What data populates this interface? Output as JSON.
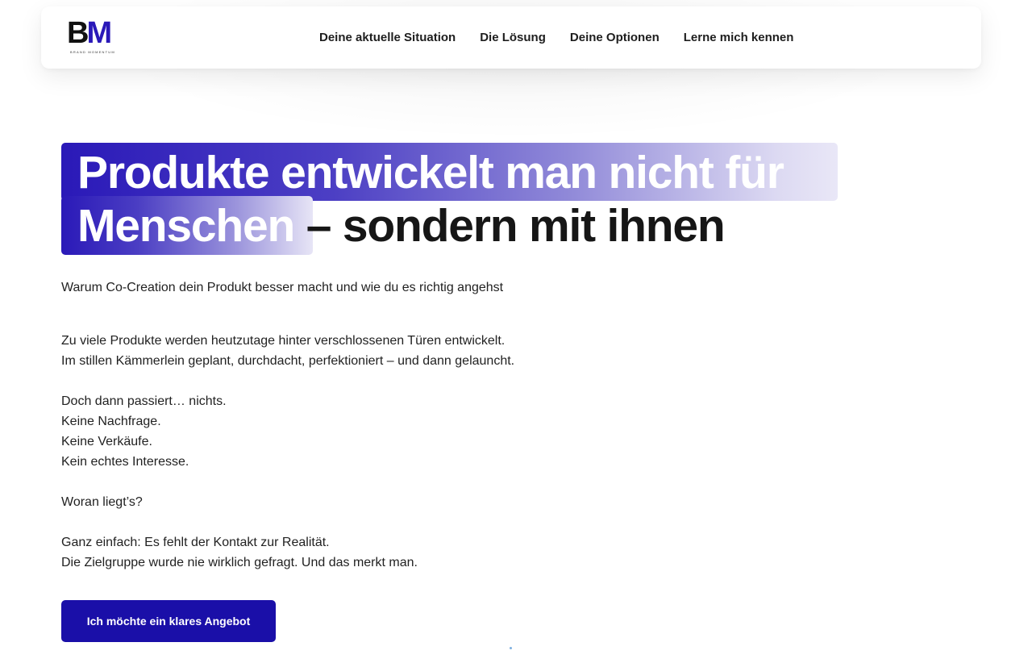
{
  "logo": {
    "mark_b": "B",
    "mark_m": "M",
    "subtitle": "BRAND MOMENTUM",
    "colors": {
      "b": "#111111",
      "m": "#2a19b8"
    }
  },
  "nav": {
    "items": [
      {
        "label": "Deine aktuelle Situation"
      },
      {
        "label": "Die Lösung"
      },
      {
        "label": "Deine Optionen"
      },
      {
        "label": "Lerne mich kennen"
      }
    ]
  },
  "hero": {
    "title_line1": "Produkte entwickelt man nicht für",
    "title_line2_highlight": "Menschen",
    "title_line2_rest": " – sondern mit ihnen",
    "subtitle": "Warum Co-Creation dein Produkt besser macht und wie du es richtig angehst"
  },
  "body": {
    "paragraphs": [
      [
        "Zu viele Produkte werden heutzutage hinter verschlossenen Türen entwickelt.",
        "Im stillen Kämmerlein geplant, durchdacht, perfektioniert – und dann gelauncht."
      ],
      [
        "Doch dann passiert… nichts.",
        "Keine Nachfrage.",
        "Keine Verkäufe.",
        "Kein echtes Interesse."
      ],
      [
        "Woran liegt’s?"
      ],
      [
        "Ganz einfach: Es fehlt der Kontakt zur Realität.",
        "Die Zielgruppe wurde nie wirklich gefragt. Und das merkt man."
      ]
    ]
  },
  "cta": {
    "label": "Ich möchte ein klares Angebot"
  },
  "colors": {
    "accent": "#1a0fa8",
    "highlight_start": "#2a19b8",
    "text": "#222222"
  }
}
